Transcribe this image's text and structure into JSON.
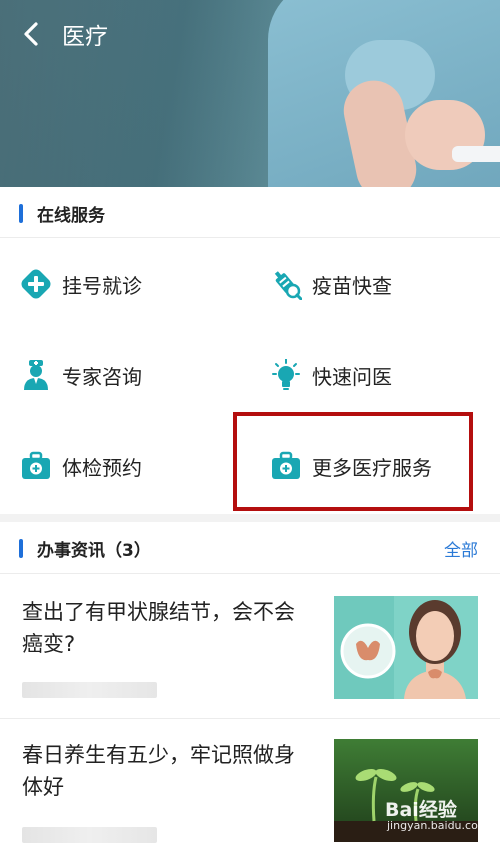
{
  "header": {
    "title": "医疗"
  },
  "online_services": {
    "title": "在线服务",
    "items": [
      {
        "label": "挂号就诊",
        "icon": "plus-circle-icon"
      },
      {
        "label": "疫苗快查",
        "icon": "vaccine-icon"
      },
      {
        "label": "专家咨询",
        "icon": "doctor-icon"
      },
      {
        "label": "快速问医",
        "icon": "lightbulb-icon"
      },
      {
        "label": "体检预约",
        "icon": "medical-kit-icon"
      },
      {
        "label": "更多医疗服务",
        "icon": "medical-kit-icon"
      }
    ]
  },
  "news": {
    "title": "办事资讯（3）",
    "all_label": "全部",
    "items": [
      {
        "headline": "查出了有甲状腺结节，会不会癌变?"
      },
      {
        "headline": "春日养生有五少，牢记照做身体好"
      }
    ]
  },
  "watermark": {
    "brand": "Bai经验",
    "url": "jingyan.baidu.com"
  },
  "colors": {
    "accent": "#1e6fd9",
    "link": "#2b7ad6",
    "icon_teal": "#19a7b3",
    "highlight_border": "#b40e0e"
  }
}
